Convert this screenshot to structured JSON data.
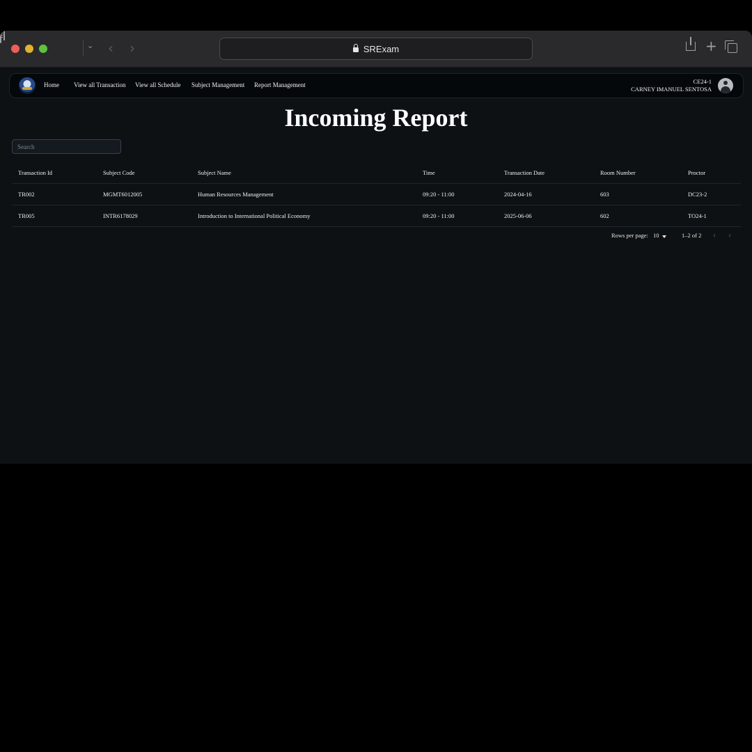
{
  "browser": {
    "url_text": "SRExam"
  },
  "navbar": {
    "items": [
      {
        "label": "Home"
      },
      {
        "label": "View all Transaction"
      },
      {
        "label": "View all Schedule"
      },
      {
        "label": "Subject Management"
      },
      {
        "label": "Report Management"
      }
    ],
    "user": {
      "code": "CE24-1",
      "name": "CARNEY IMANUEL SENTOSA"
    }
  },
  "page": {
    "title": "Incoming Report",
    "search_placeholder": "Search"
  },
  "table": {
    "columns": [
      "Transaction Id",
      "Subject Code",
      "Subject Name",
      "Time",
      "Transaction Date",
      "Room Number",
      "Proctor"
    ],
    "rows": [
      [
        "TR002",
        "MGMT6012005",
        "Human Resources Management",
        "09:20 - 11:00",
        "2024-04-16",
        "603",
        "DC23-2"
      ],
      [
        "TR005",
        "INTR6178029",
        "Introduction to International Political Economy",
        "09:20 - 11:00",
        "2025-06-06",
        "602",
        "TO24-1"
      ]
    ]
  },
  "pagination": {
    "rows_per_page_label": "Rows per page:",
    "rows_per_page_value": "10",
    "range_text": "1–2 of 2"
  },
  "icons": {
    "prev": "chevron-left-icon",
    "next": "chevron-right-icon"
  },
  "colors": {
    "background": "#0d1114",
    "navbar": "#05080a",
    "text": "#f0f0f0"
  }
}
